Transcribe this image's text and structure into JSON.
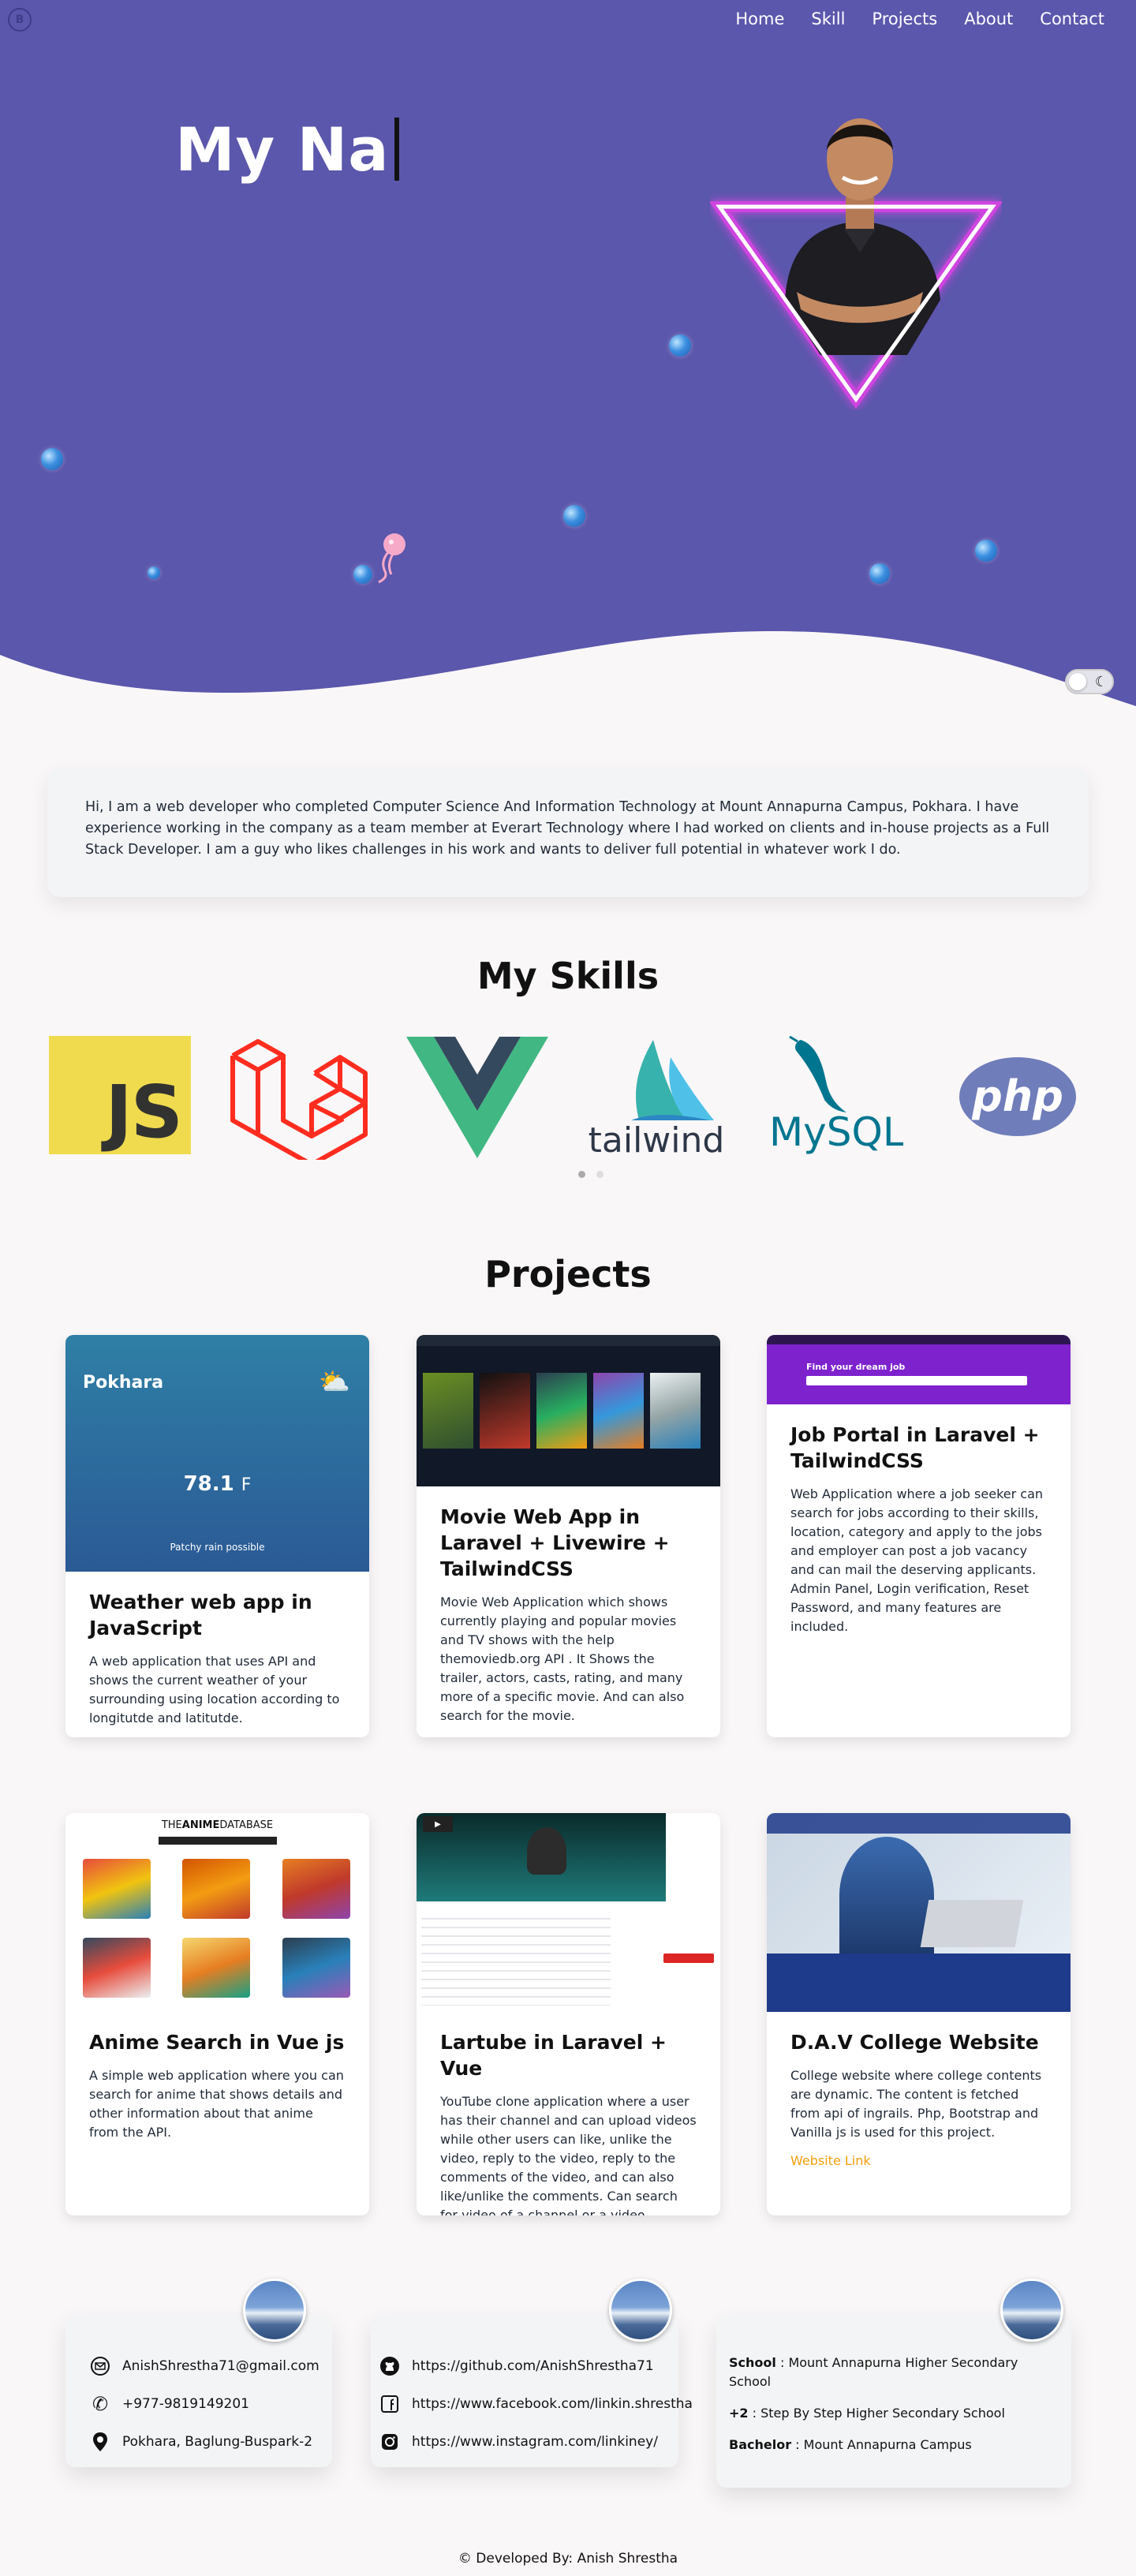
{
  "nav": {
    "logo": "B",
    "items": [
      "Home",
      "Skill",
      "Projects",
      "About",
      "Contact"
    ]
  },
  "hero": {
    "typed_text": "My Na",
    "theme_toggle_icon": "moon-icon"
  },
  "about": {
    "text": "Hi, I am a web developer who completed Computer Science And Information Technology at Mount Annapurna Campus, Pokhara. I have experience working in the company as a team member at Everart Technology where I had worked on clients and in-house projects as a Full Stack Developer. I am a guy who likes challenges in his work and wants to deliver full potential in whatever work I do."
  },
  "skills": {
    "title": "My Skills",
    "items": [
      "JS",
      "laravel",
      "vue",
      "tailwind",
      "MySQL",
      "php"
    ]
  },
  "projects": {
    "title": "Projects",
    "items": [
      {
        "title": "Weather web app in JavaScript",
        "desc": "A web application that uses API and shows the current weather of your surrounding using location according to longitutde and latitutde."
      },
      {
        "title": "Movie Web App in Laravel + Livewire + TailwindCSS",
        "desc": "Movie Web Application which shows currently playing and popular movies and TV shows with the help themoviedb.org API . It Shows the trailer, actors, casts, rating, and many more of a specific movie. And can also search for the movie."
      },
      {
        "title": "Job Portal in Laravel + TailwindCSS",
        "desc": "Web Application where a job seeker can search for jobs according to their skills, location, category and apply to the jobs and employer can post a job vacancy and can mail the deserving applicants. Admin Panel, Login verification, Reset Password, and many features are included."
      },
      {
        "title": "Anime Search in Vue js",
        "desc": "A simple web application where you can search for anime that shows details and other information about that anime from the API."
      },
      {
        "title": "Lartube in Laravel + Vue",
        "desc": "YouTube clone application where a user has their channel and can upload videos while other users can like, unlike the video, reply to the video, reply to the comments of the video, and can also like/unlike the comments. Can search for video of a channel or a video."
      },
      {
        "title": "D.A.V College Website",
        "desc": "College website where college contents are dynamic. The content is fetched from api of ingrails. Php, Bootstrap and Vanilla js is used for this project.",
        "link": "Website Link"
      }
    ],
    "weather_preview": {
      "city": "Pokhara",
      "temp": "78.1",
      "unit": "F",
      "condition": "Patchy rain possible"
    },
    "job_preview": {
      "headline": "Find your dream job"
    },
    "anime_preview": {
      "brand_pre": "THE",
      "brand_bold": "ANIME",
      "brand_post": "DATABASE"
    }
  },
  "contact": {
    "email": "AnishShrestha71@gmail.com",
    "phone": "+977-9819149201",
    "address": "Pokhara, Baglung-Buspark-2",
    "github": "https://github.com/AnishShrestha71",
    "facebook": "https://www.facebook.com/linkin.shrestha",
    "instagram": "https://www.instagram.com/linkiney/",
    "school_label": "School",
    "school": " : Mount Annapurna Higher Secondary School",
    "plus2_label": "+2",
    "plus2": " : Step By Step Higher Secondary School",
    "bachelor_label": "Bachelor",
    "bachelor": " : Mount Annapurna Campus"
  },
  "footer": {
    "text": "© Developed By: Anish Shrestha"
  },
  "colors": {
    "hero": "#5b57ac",
    "accent": "#f59e0b",
    "neon": "#ff3df5"
  }
}
